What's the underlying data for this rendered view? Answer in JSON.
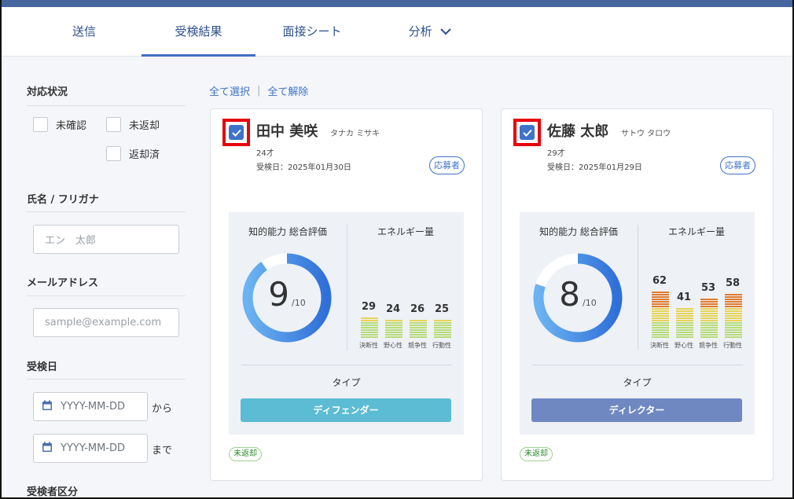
{
  "tabs": [
    {
      "label": "送信"
    },
    {
      "label": "受検結果",
      "active": true
    },
    {
      "label": "面接シート"
    },
    {
      "label": "分析",
      "icon": "chevron-down-icon"
    }
  ],
  "sidebar": {
    "response_status": {
      "title": "対応状況",
      "options": [
        {
          "label": "未確認",
          "checked": false
        },
        {
          "label": "未返却",
          "checked": false
        },
        {
          "label": "返却済",
          "checked": false
        }
      ]
    },
    "name": {
      "title": "氏名 / フリガナ",
      "placeholder": "エン　太郎"
    },
    "email": {
      "title": "メールアドレス",
      "placeholder": "sample@example.com"
    },
    "exam_date": {
      "title": "受検日",
      "from_placeholder": "YYYY-MM-DD",
      "from_suffix": "から",
      "to_placeholder": "YYYY-MM-DD",
      "to_suffix": "まで",
      "icon": "calendar-icon"
    },
    "examinee_type": {
      "title": "受検者区分"
    }
  },
  "actions": {
    "select_all": "全て選択",
    "separator": "|",
    "deselect_all": "全て解除"
  },
  "labels": {
    "intellect": "知的能力 総合評価",
    "energy": "エネルギー量",
    "type": "タイプ",
    "score_denominator": "/10"
  },
  "bar_labels": [
    "決断性",
    "野心性",
    "競争性",
    "行動性"
  ],
  "cards": [
    {
      "selected": true,
      "name": "田中 美咲",
      "kana": "タナカ ミサキ",
      "age": "24才",
      "exam_date": "受検日：2025年01月30日",
      "badge": "応募者",
      "score": "9",
      "score_fraction": 0.9,
      "energy": [
        29,
        24,
        26,
        25
      ],
      "type_label": "ディフェンダー",
      "type_color": "#5bbcd3",
      "status": "未返却"
    },
    {
      "selected": true,
      "name": "佐藤 太郎",
      "kana": "サトウ タロウ",
      "age": "29才",
      "exam_date": "受検日：2025年01月29日",
      "badge": "応募者",
      "score": "8",
      "score_fraction": 0.8,
      "energy": [
        62,
        41,
        53,
        58
      ],
      "type_label": "ディレクター",
      "type_color": "#6f88c2",
      "status": "未返却"
    }
  ],
  "colors": {
    "topbar": "#46679e",
    "accent": "#3f72c9",
    "highlight_border": "#e8000b",
    "donut_track": "#ffffff",
    "bar_low": "#b8dc7a",
    "bar_mid": "#e6d456",
    "bar_high": "#e07b2d"
  }
}
